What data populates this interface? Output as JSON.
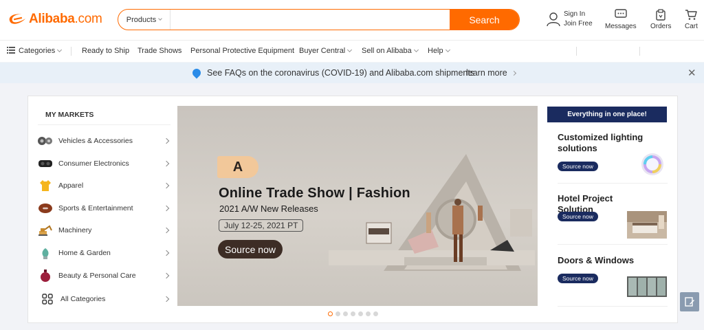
{
  "header": {
    "logo_text": "Alibaba",
    "logo_domain": ".com",
    "search": {
      "category": "Products",
      "placeholder": "",
      "button": "Search"
    },
    "signin": {
      "line1": "Sign In",
      "line2": "Join Free"
    },
    "messages": "Messages",
    "orders": "Orders",
    "cart": "Cart"
  },
  "nav": {
    "categories": "Categories",
    "ready_to_ship": "Ready to Ship",
    "trade_shows": "Trade Shows",
    "ppe": "Personal Protective Equipment",
    "buyer_central": "Buyer Central",
    "sell": "Sell on Alibaba",
    "help": "Help"
  },
  "notice": {
    "text": "See FAQs on the coronavirus (COVID-19) and Alibaba.com shipments",
    "link": "learn more"
  },
  "markets": {
    "title": "MY MARKETS",
    "items": [
      {
        "label": "Vehicles & Accessories",
        "icon": "vehicle-icon"
      },
      {
        "label": "Consumer Electronics",
        "icon": "vr-headset-icon"
      },
      {
        "label": "Apparel",
        "icon": "shirt-icon"
      },
      {
        "label": "Sports & Entertainment",
        "icon": "football-icon"
      },
      {
        "label": "Machinery",
        "icon": "excavator-icon"
      },
      {
        "label": "Home & Garden",
        "icon": "plant-icon"
      },
      {
        "label": "Beauty & Personal Care",
        "icon": "perfume-icon"
      }
    ],
    "all": "All Categories"
  },
  "hero": {
    "badge": "A",
    "title": "Online Trade Show | Fashion",
    "subtitle": "2021 A/W New Releases",
    "date": "July 12-25, 2021 PT",
    "cta": "Source now",
    "slides": 7,
    "active_slide": 1
  },
  "promo": {
    "head": "Everything in one place!",
    "items": [
      {
        "title": "Customized lighting solutions",
        "cta": "Source now"
      },
      {
        "title": "Hotel Project Solution",
        "cta": "Source now"
      },
      {
        "title": "Doors & Windows",
        "cta": "Source now"
      }
    ]
  },
  "colors": {
    "brand": "#ff6a00",
    "navy": "#1a2b5f",
    "notice_bg": "#e8f0f8"
  }
}
